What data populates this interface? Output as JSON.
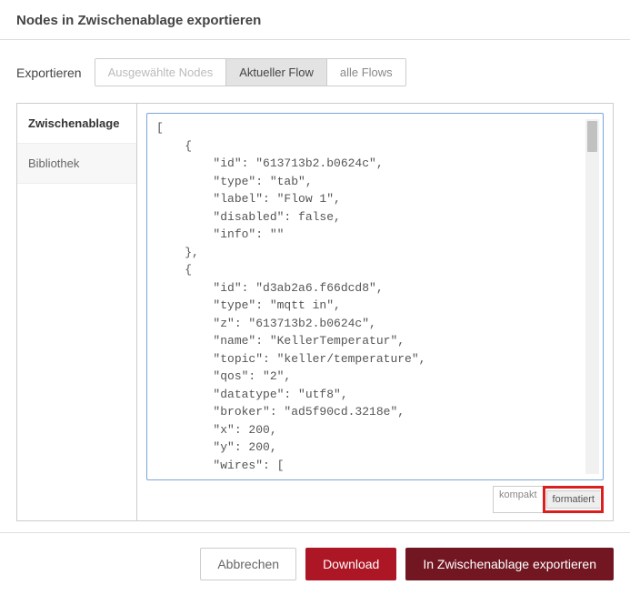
{
  "dialog_title": "Nodes in Zwischenablage exportieren",
  "export_label": "Exportieren",
  "scope_tabs": [
    {
      "label": "Ausgewählte Nodes",
      "state": "disabled"
    },
    {
      "label": "Aktueller Flow",
      "state": "active"
    },
    {
      "label": "alle Flows",
      "state": "normal"
    }
  ],
  "sidebar": {
    "items": [
      {
        "label": "Zwischenablage",
        "active": true
      },
      {
        "label": "Bibliothek",
        "active": false
      }
    ]
  },
  "code_text": "[\n    {\n        \"id\": \"613713b2.b0624c\",\n        \"type\": \"tab\",\n        \"label\": \"Flow 1\",\n        \"disabled\": false,\n        \"info\": \"\"\n    },\n    {\n        \"id\": \"d3ab2a6.f66dcd8\",\n        \"type\": \"mqtt in\",\n        \"z\": \"613713b2.b0624c\",\n        \"name\": \"KellerTemperatur\",\n        \"topic\": \"keller/temperature\",\n        \"qos\": \"2\",\n        \"datatype\": \"utf8\",\n        \"broker\": \"ad5f90cd.3218e\",\n        \"x\": 200,\n        \"y\": 200,\n        \"wires\": [",
  "format": {
    "compact": "kompakt",
    "formatted": "formatiert"
  },
  "footer": {
    "cancel": "Abbrechen",
    "download": "Download",
    "export": "In Zwischenablage exportieren"
  }
}
